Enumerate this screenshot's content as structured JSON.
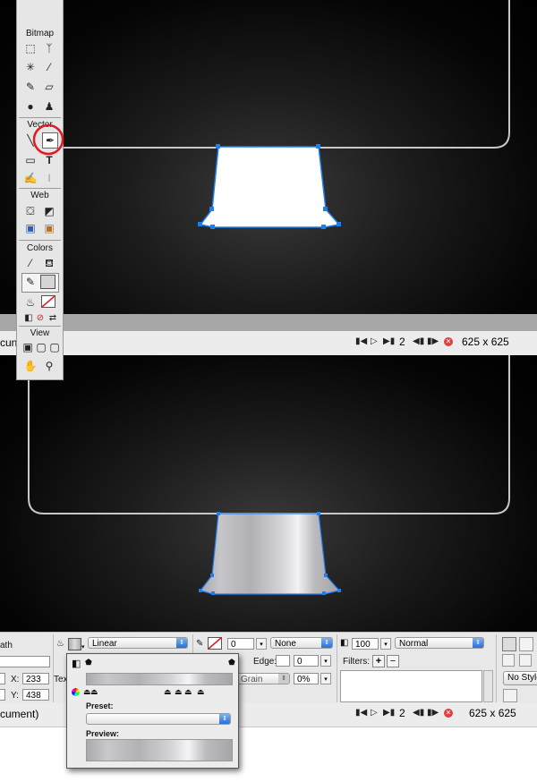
{
  "toolbox": {
    "sections": {
      "bitmap": "Bitmap",
      "vector": "Vector",
      "web": "Web",
      "colors": "Colors",
      "view": "View"
    },
    "highlight_color": "#e11b22",
    "highlighted_tool": "pen-icon"
  },
  "canvas": {
    "background": "#000000",
    "frame_stroke": "#c8c8c8",
    "selection_color": "#1e7ff0",
    "top_shape_fill": "#ffffff"
  },
  "status_bar_top": {
    "label": "cun",
    "page": "2",
    "size": "625 x 625"
  },
  "status_bar_bottom": {
    "label": "cument)",
    "page": "2",
    "size": "625 x 625"
  },
  "inspector": {
    "left_label": "ath",
    "x_label": "X:",
    "x_value": "233",
    "y_label": "Y:",
    "y_value": "438",
    "text_label": "Tex",
    "fill_type": "Linear",
    "stroke_size": "0",
    "stroke_type": "None",
    "edge_label": "Edge:",
    "edge_value": "0",
    "texture_label": "Grain",
    "texture_value": "0%",
    "opacity": "100",
    "blend_mode": "Normal",
    "filters_label": "Filters:",
    "filters_add": "+",
    "filters_remove": "−",
    "style_label": "No Style"
  },
  "gradient_popup": {
    "preset_label": "Preset:",
    "preview_label": "Preview:",
    "preset_value": ""
  }
}
